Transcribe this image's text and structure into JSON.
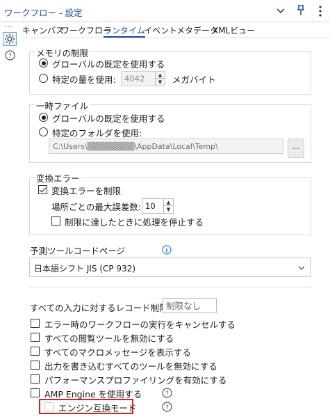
{
  "window": {
    "title": "ワークフロー - 設定"
  },
  "tabs": [
    {
      "label": "キャンバス"
    },
    {
      "label": "ワークフロー"
    },
    {
      "label": "ランタイム"
    },
    {
      "label": "イベント"
    },
    {
      "label": "メタデータ"
    },
    {
      "label": "XMLビュー"
    }
  ],
  "active_tab": "ランタイム",
  "memory": {
    "heading": "メモリの制限",
    "opt_global": "グローバルの既定を使用する",
    "opt_specific": "特定の量を使用:",
    "amount": "4042",
    "unit": "メガバイト",
    "selected": "global"
  },
  "temp": {
    "heading": "一時ファイル",
    "opt_global": "グローバルの既定を使用する",
    "opt_specific": "特定のフォルダを使用:",
    "path": "C:\\Users\\▒▒▒▒▒▒▒▒\\AppData\\Local\\Temp\\",
    "browse": "...",
    "selected": "global"
  },
  "conversion": {
    "heading": "変換エラー",
    "limit_label": "変換エラーを制限",
    "limit_checked": true,
    "max_label": "場所ごとの最大誤差数:",
    "max_value": "10",
    "stop_label": "制限に達したときに処理を停止する",
    "stop_checked": false
  },
  "codepage": {
    "label": "予測ツールコードページ",
    "value": "日本語シフト JIS (CP 932)"
  },
  "record_limit": {
    "label": "すべての入力に対するレコード制限:",
    "placeholder": "制限なし"
  },
  "options": [
    {
      "label": "エラー時のワークフローの実行をキャンセルする",
      "checked": false
    },
    {
      "label": "すべての閲覧ツールを無効にする",
      "checked": false
    },
    {
      "label": "すべてのマクロメッセージを表示する",
      "checked": false
    },
    {
      "label": "出力を書き込むすべてのツールを無効にする",
      "checked": false
    },
    {
      "label": "パフォーマンスプロファイリングを有効にする",
      "checked": false
    },
    {
      "label": "AMP Engine を使用する",
      "checked": false
    }
  ],
  "engine_compat": {
    "label": "エンジン互換モード",
    "checked": false,
    "enabled": false
  },
  "colors": {
    "accent": "#1f4ea0",
    "highlight": "#e0201f",
    "info": "#2b7ad4"
  }
}
